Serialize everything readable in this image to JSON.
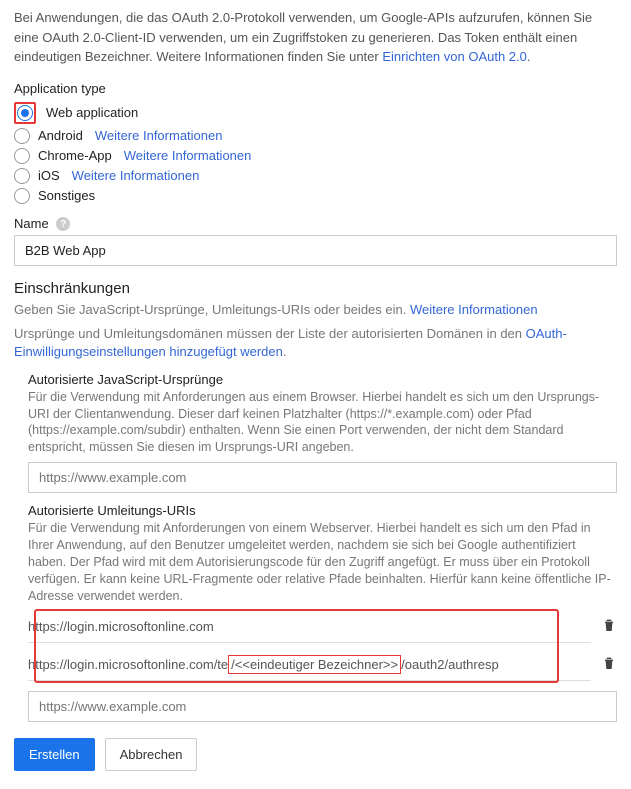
{
  "intro": {
    "text": "Bei Anwendungen, die das OAuth 2.0-Protokoll verwenden, um Google-APIs aufzurufen, können Sie eine OAuth 2.0-Client-ID verwenden, um ein Zugriffstoken zu generieren. Das Token enthält einen eindeutigen Bezeichner. Weitere Informationen finden Sie unter ",
    "link": "Einrichten von OAuth 2.0",
    "suffix": "."
  },
  "app_type": {
    "label": "Application type",
    "options": [
      {
        "label": "Web application",
        "selected": true,
        "more": null
      },
      {
        "label": "Android",
        "selected": false,
        "more": "Weitere Informationen"
      },
      {
        "label": "Chrome-App",
        "selected": false,
        "more": "Weitere Informationen"
      },
      {
        "label": "iOS",
        "selected": false,
        "more": "Weitere Informationen"
      },
      {
        "label": "Sonstiges",
        "selected": false,
        "more": null
      }
    ]
  },
  "name": {
    "label": "Name",
    "value": "B2B Web App"
  },
  "restrictions": {
    "heading": "Einschränkungen",
    "desc_prefix": "Geben Sie JavaScript-Ursprünge, Umleitungs-URIs oder beides ein. ",
    "desc_link": "Weitere Informationen",
    "note_prefix": "Ursprünge und Umleitungsdomänen müssen der Liste der autorisierten Domänen in den ",
    "note_link": "OAuth-Einwilligungseinstellungen hinzugefügt werden",
    "note_suffix": "."
  },
  "js_origins": {
    "label": "Autorisierte JavaScript-Ursprünge",
    "desc": "Für die Verwendung mit Anforderungen aus einem Browser. Hierbei handelt es sich um den Ursprungs-URI der Clientanwendung. Dieser darf keinen Platzhalter (https://*.example.com) oder Pfad (https://example.com/subdir) enthalten. Wenn Sie einen Port verwenden, der nicht dem Standard entspricht, müssen Sie diesen im Ursprungs-URI angeben.",
    "placeholder": "https://www.example.com"
  },
  "redirect_uris": {
    "label": "Autorisierte Umleitungs-URIs",
    "desc": "Für die Verwendung mit Anforderungen von einem Webserver. Hierbei handelt es sich um den Pfad in Ihrer Anwendung, auf den Benutzer umgeleitet werden, nachdem sie sich bei Google authentifiziert haben. Der Pfad wird mit dem Autorisierungscode für den Zugriff angefügt. Er muss über ein Protokoll verfügen. Er kann keine URL-Fragmente oder relative Pfade beinhalten. Hierfür kann keine öffentliche IP-Adresse verwendet werden.",
    "items": [
      {
        "prefix": "https://login.microsoftonline.com",
        "highlight": null,
        "suffix": ""
      },
      {
        "prefix": "https://login.microsoftonline.com/te",
        "highlight": "/<<eindeutiger Bezeichner>>",
        "suffix": "/oauth2/authresp"
      }
    ],
    "placeholder": "https://www.example.com"
  },
  "buttons": {
    "create": "Erstellen",
    "cancel": "Abbrechen"
  }
}
